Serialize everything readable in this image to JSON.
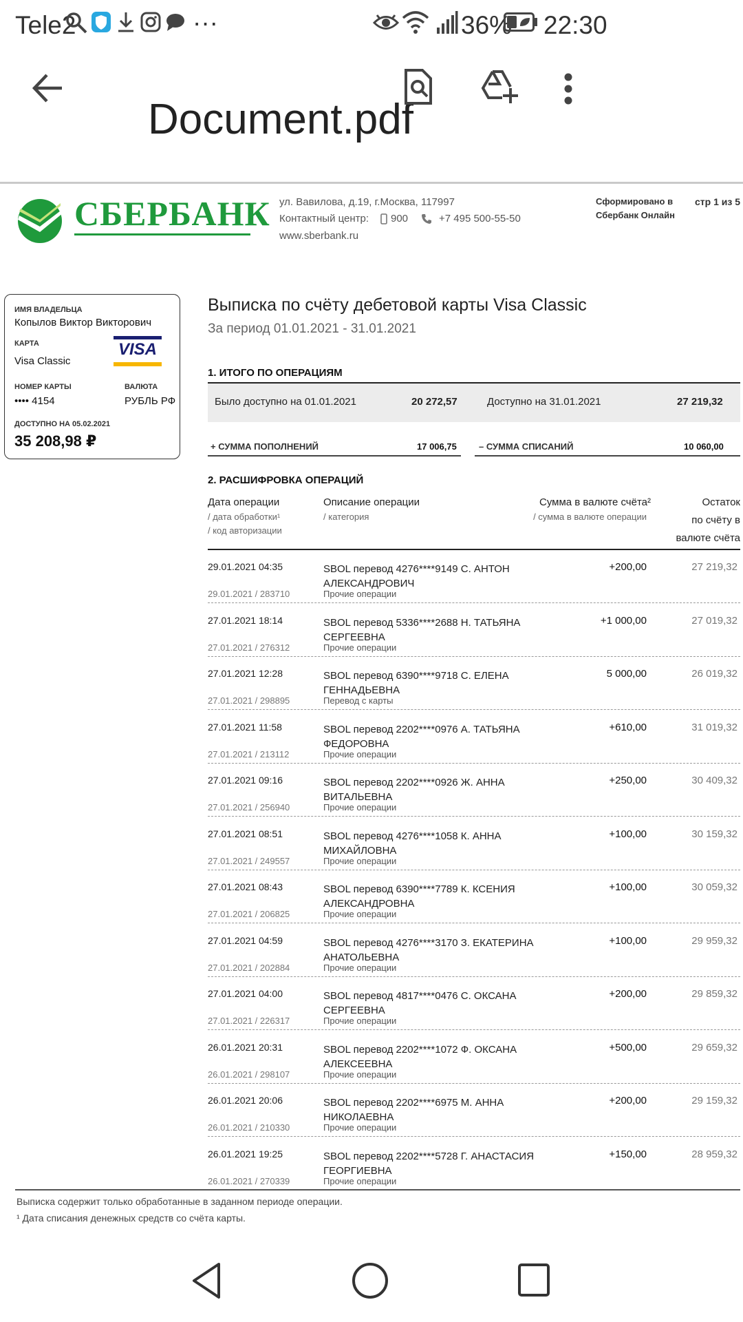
{
  "status_bar": {
    "carrier": "Tele2",
    "battery": "36%",
    "time": "22:30",
    "more": "···"
  },
  "app_bar": {
    "title": "Document.pdf"
  },
  "header": {
    "bank_name": "СБЕРБАНК",
    "address": "ул. Вавилова, д.19, г.Москва, 117997",
    "contact_label": "Контактный центр:",
    "phone_short": "900",
    "phone_long": "+7 495 500-55-50",
    "website": "www.sberbank.ru",
    "formed_line1": "Сформировано в",
    "formed_line2": "Сбербанк Онлайн",
    "page_info": "стр 1 из 5"
  },
  "card": {
    "owner_label": "ИМЯ ВЛАДЕЛЬЦА",
    "owner": "Копылов Виктор Викторович",
    "card_label": "КАРТА",
    "card_type": "Visa Classic",
    "brand": "VISA",
    "number_label": "НОМЕР КАРТЫ",
    "number": "•••• 4154",
    "currency_label": "ВАЛЮТА",
    "currency": "РУБЛЬ РФ",
    "available_label": "ДОСТУПНО НА 05.02.2021",
    "available": "35 208,98 ₽"
  },
  "statement": {
    "title": "Выписка по счёту дебетовой карты Visa Classic",
    "period": "За период 01.01.2021 - 31.01.2021",
    "section1": "1. ИТОГО ПО ОПЕРАЦИЯМ",
    "was_label": "Было доступно на 01.01.2021",
    "was_value": "20 272,57",
    "now_label": "Доступно на 31.01.2021",
    "now_value": "27 219,32",
    "in_label": "+ СУММА ПОПОЛНЕНИЙ",
    "in_value": "17 006,75",
    "out_label": "– СУММА СПИСАНИЙ",
    "out_value": "10 060,00",
    "section2": "2. РАСШИФРОВКА ОПЕРАЦИЙ"
  },
  "columns": {
    "date": "Дата операции",
    "date_sub1": "/ дата обработки¹",
    "date_sub2": "/ код авторизации",
    "desc": "Описание операции",
    "desc_sub": "/ категория",
    "amount": "Сумма в валюте счёта²",
    "amount_sub": "/ сумма в валюте операции",
    "balance1": "Остаток",
    "balance2": "по счёту в",
    "balance3": "валюте счёта"
  },
  "rows": [
    {
      "date": "29.01.2021 04:35",
      "sub": "29.01.2021 / 283710",
      "desc1": "SBOL перевод 4276****9149 С. АНТОН",
      "desc2": "АЛЕКСАНДРОВИЧ",
      "cat": "Прочие операции",
      "amount": "+200,00",
      "balance": "27 219,32"
    },
    {
      "date": "27.01.2021 18:14",
      "sub": "27.01.2021 / 276312",
      "desc1": "SBOL перевод 5336****2688 Н. ТАТЬЯНА",
      "desc2": "СЕРГЕЕВНА",
      "cat": "Прочие операции",
      "amount": "+1 000,00",
      "balance": "27 019,32"
    },
    {
      "date": "27.01.2021 12:28",
      "sub": "27.01.2021 / 298895",
      "desc1": "SBOL перевод 6390****9718 С. ЕЛЕНА",
      "desc2": "ГЕННАДЬЕВНА",
      "cat": "Перевод с карты",
      "amount": "5 000,00",
      "balance": "26 019,32"
    },
    {
      "date": "27.01.2021 11:58",
      "sub": "27.01.2021 / 213112",
      "desc1": "SBOL перевод 2202****0976 А. ТАТЬЯНА",
      "desc2": "ФЕДОРОВНА",
      "cat": "Прочие операции",
      "amount": "+610,00",
      "balance": "31 019,32"
    },
    {
      "date": "27.01.2021 09:16",
      "sub": "27.01.2021 / 256940",
      "desc1": "SBOL перевод 2202****0926 Ж. АННА",
      "desc2": "ВИТАЛЬЕВНА",
      "cat": "Прочие операции",
      "amount": "+250,00",
      "balance": "30 409,32"
    },
    {
      "date": "27.01.2021 08:51",
      "sub": "27.01.2021 / 249557",
      "desc1": "SBOL перевод 4276****1058 К. АННА",
      "desc2": "МИХАЙЛОВНА",
      "cat": "Прочие операции",
      "amount": "+100,00",
      "balance": "30 159,32"
    },
    {
      "date": "27.01.2021 08:43",
      "sub": "27.01.2021 / 206825",
      "desc1": "SBOL перевод 6390****7789 К. КСЕНИЯ",
      "desc2": "АЛЕКСАНДРОВНА",
      "cat": "Прочие операции",
      "amount": "+100,00",
      "balance": "30 059,32"
    },
    {
      "date": "27.01.2021 04:59",
      "sub": "27.01.2021 / 202884",
      "desc1": "SBOL перевод 4276****3170 З. ЕКАТЕРИНА",
      "desc2": "АНАТОЛЬЕВНА",
      "cat": "Прочие операции",
      "amount": "+100,00",
      "balance": "29 959,32"
    },
    {
      "date": "27.01.2021 04:00",
      "sub": "27.01.2021 / 226317",
      "desc1": "SBOL перевод 4817****0476 С. ОКСАНА",
      "desc2": "СЕРГЕЕВНА",
      "cat": "Прочие операции",
      "amount": "+200,00",
      "balance": "29 859,32"
    },
    {
      "date": "26.01.2021 20:31",
      "sub": "26.01.2021 / 298107",
      "desc1": "SBOL перевод 2202****1072 Ф. ОКСАНА",
      "desc2": "АЛЕКСЕЕВНА",
      "cat": "Прочие операции",
      "amount": "+500,00",
      "balance": "29 659,32"
    },
    {
      "date": "26.01.2021 20:06",
      "sub": "26.01.2021 / 210330",
      "desc1": "SBOL перевод 2202****6975 М. АННА",
      "desc2": "НИКОЛАЕВНА",
      "cat": "Прочие операции",
      "amount": "+200,00",
      "balance": "29 159,32"
    },
    {
      "date": "26.01.2021 19:25",
      "sub": "26.01.2021 / 270339",
      "desc1": "SBOL перевод 2202****5728 Г. АНАСТАСИЯ",
      "desc2": "ГЕОРГИЕВНА",
      "cat": "Прочие операции",
      "amount": "+150,00",
      "balance": "28 959,32"
    }
  ],
  "footer": {
    "note": "Выписка содержит только обработанные в заданном периоде операции.",
    "note1": "¹ Дата списания денежных средств со счёта карты."
  },
  "colors": {
    "sber_green": "#1f9a3c",
    "visa_blue": "#1a1f71",
    "visa_gold": "#f7b600",
    "summary_bg": "#ececec"
  },
  "icons": [
    "search-icon",
    "shield-icon",
    "download-icon",
    "instagram-icon",
    "chat-icon",
    "eye-icon",
    "wifi-icon",
    "signal-icon",
    "battery-icon",
    "back-arrow-icon",
    "find-in-document-icon",
    "add-to-drive-icon",
    "more-vert-icon",
    "nav-back-icon",
    "nav-home-icon",
    "nav-recents-icon"
  ]
}
